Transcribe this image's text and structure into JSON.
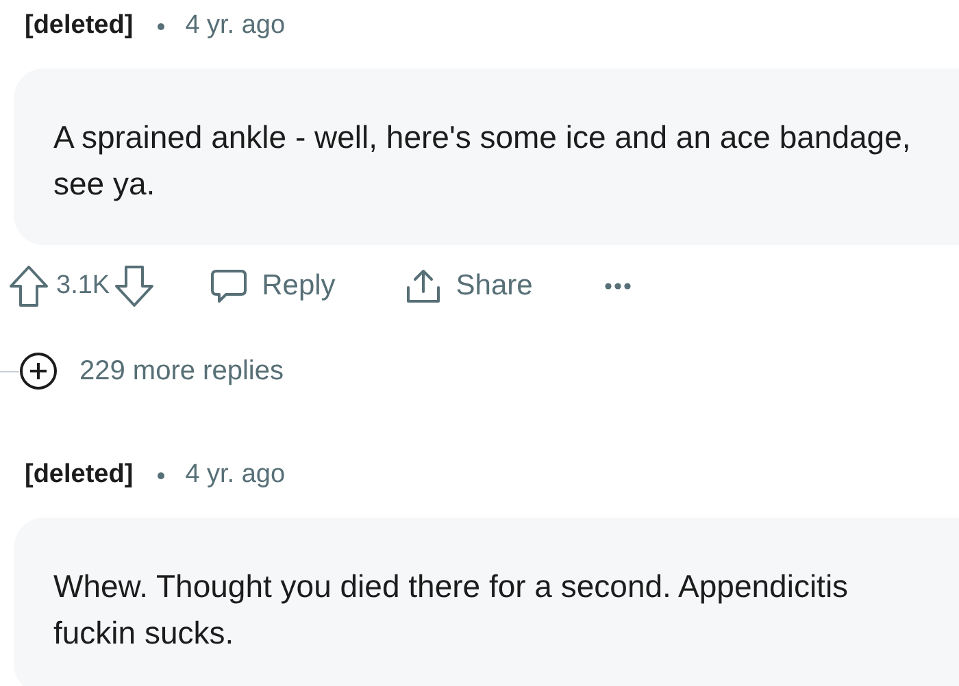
{
  "comments": [
    {
      "author": "[deleted]",
      "time": "4 yr. ago",
      "body": "A sprained ankle - well, here's some ice and an ace bandage, see ya.",
      "actions": {
        "score": "3.1K",
        "reply": "Reply",
        "share": "Share"
      },
      "more_replies": "229 more replies"
    },
    {
      "author": "[deleted]",
      "time": "4 yr. ago",
      "body": "Whew. Thought you died there for a second. Appendicitis fuckin sucks."
    }
  ]
}
